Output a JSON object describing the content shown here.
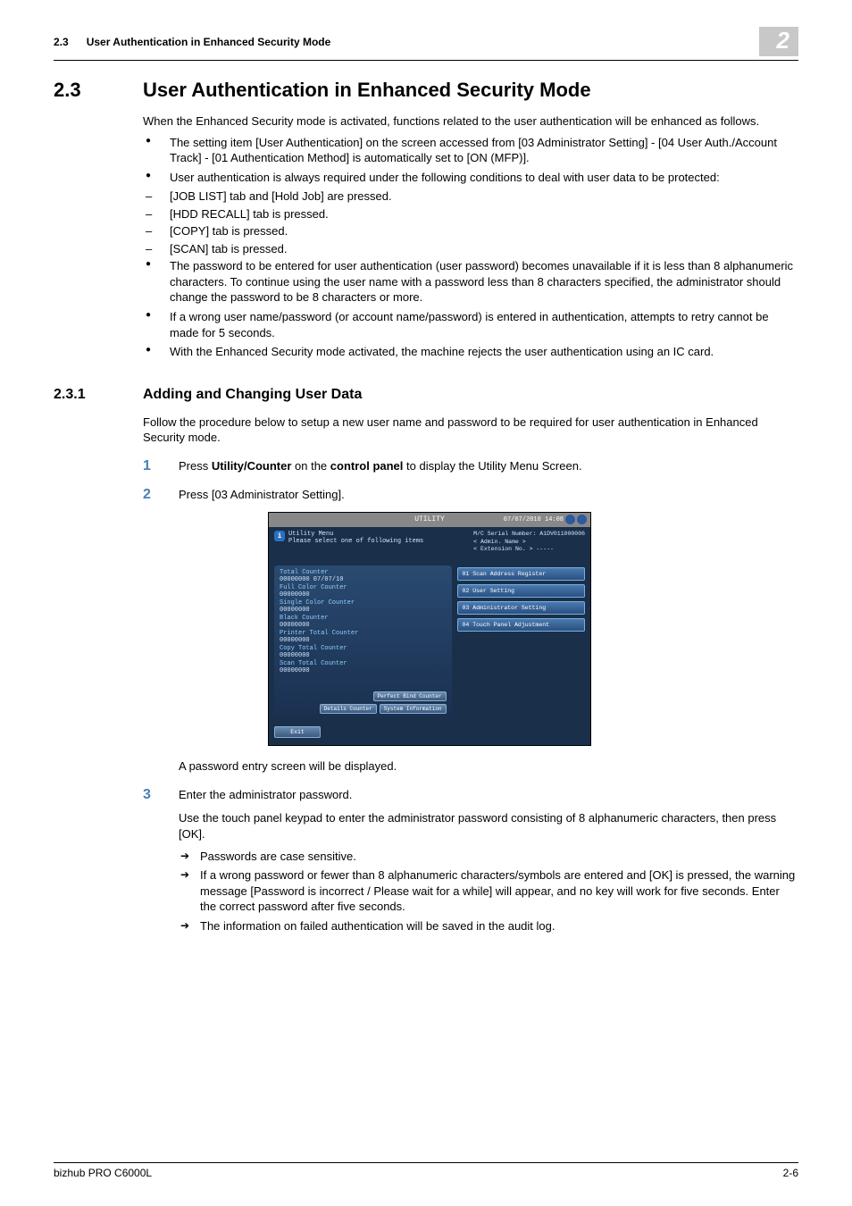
{
  "header": {
    "section_ref": "2.3",
    "running_title": "User Authentication in Enhanced Security Mode",
    "chapter_badge": "2"
  },
  "section": {
    "number": "2.3",
    "title": "User Authentication in Enhanced Security Mode",
    "intro": "When the Enhanced Security mode is activated, functions related to the user authentication will be enhanced as follows.",
    "bullets_top": [
      "The setting item [User Authentication] on the screen accessed from [03 Administrator Setting] - [04 User Auth./Account Track] - [01 Authentication Method] is automatically set to [ON (MFP)].",
      "User authentication is always required under the following conditions to deal with user data to be protected:"
    ],
    "dashes": [
      "[JOB LIST] tab and [Hold Job] are pressed.",
      "[HDD RECALL] tab is pressed.",
      "[COPY] tab is pressed.",
      "[SCAN] tab is pressed."
    ],
    "bullets_bottom": [
      "The password to be entered for user authentication (user password) becomes unavailable if it is less than 8 alphanumeric characters. To continue using the user name with a password less than 8 characters specified, the administrator should change the password to be 8 characters or more.",
      "If a wrong user name/password (or account name/password) is entered in authentication, attempts to retry cannot be made for 5 seconds.",
      "With the Enhanced Security mode activated, the machine rejects the user authentication using an IC card."
    ]
  },
  "subsection": {
    "number": "2.3.1",
    "title": "Adding and Changing User Data",
    "intro": "Follow the procedure below to setup a new user name and password to be required for user authentication in Enhanced Security mode.",
    "steps": {
      "1": {
        "text_prefix": "Press ",
        "b1": "Utility/Counter",
        "mid": " on the ",
        "b2": "control panel",
        "suffix": " to display the Utility Menu Screen."
      },
      "2": {
        "text": "Press [03 Administrator Setting]."
      },
      "after2": "A password entry screen will be displayed.",
      "3": {
        "text": "Enter the administrator password.",
        "sub": "Use the touch panel keypad to enter the administrator password consisting of 8 alphanumeric characters, then press [OK].",
        "arrows": [
          "Passwords are case sensitive.",
          "If a wrong password or fewer than 8 alphanumeric characters/symbols are entered and [OK] is pressed, the warning message [Password is incorrect / Please wait for a while] will appear, and no key will work for five seconds. Enter the correct password after five seconds.",
          "The information on failed authentication will be saved in the audit log."
        ]
      }
    }
  },
  "figure": {
    "titlebar": "UTILITY",
    "date": "07/07/2010  14:08",
    "info_title": "Utility Menu",
    "info_sub": "Please select one of following items",
    "right_info": {
      "l1": "M/C Serial Number: A1DV011000006",
      "l2": "< Admin. Name  >",
      "l3": "< Extension No. >  -----"
    },
    "counters": [
      {
        "label": "Total Counter",
        "val": "00000000  07/07/10"
      },
      {
        "label": "Full Color Counter",
        "val": "00000000"
      },
      {
        "label": "Single Color Counter",
        "val": "00000000"
      },
      {
        "label": "Black Counter",
        "val": "00000000"
      },
      {
        "label": "Printer Total Counter",
        "val": "00000000"
      },
      {
        "label": "Copy Total Counter",
        "val": "00000000"
      },
      {
        "label": "Scan Total Counter",
        "val": "00000000"
      }
    ],
    "left_btns": {
      "top": "Perfect Bind Counter",
      "l": "Details Counter",
      "r": "System Information"
    },
    "menu": [
      "01 Scan Address Register",
      "02 User Setting",
      "03 Administrator Setting",
      "04 Touch Panel Adjustment"
    ],
    "exit": "Exit"
  },
  "footer": {
    "left": "bizhub PRO C6000L",
    "right": "2-6"
  }
}
